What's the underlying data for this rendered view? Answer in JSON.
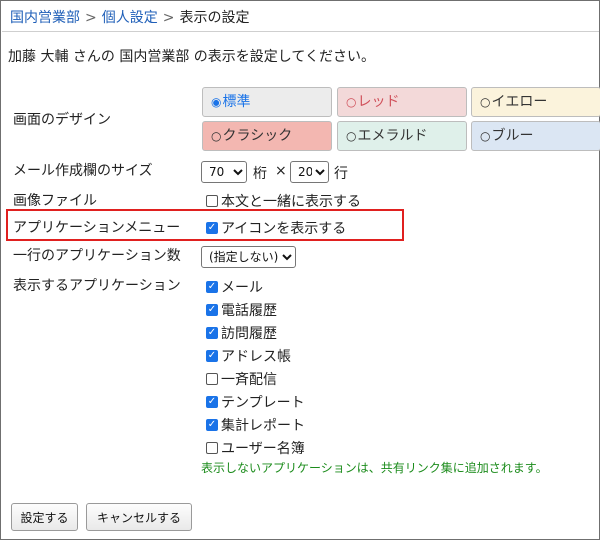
{
  "breadcrumb": {
    "items": [
      "国内営業部",
      "個人設定"
    ],
    "current": "表示の設定",
    "separator": ">"
  },
  "intro": "加藤 大輔 さんの 国内営業部 の表示を設定してください。",
  "design": {
    "label": "画面のデザイン",
    "selected": "標準",
    "options": [
      {
        "label": "標準",
        "bg": "#ececec",
        "color": "#1a73e8",
        "dot": "◉"
      },
      {
        "label": "レッド",
        "bg": "#f3d9d9",
        "color": "#d0505a",
        "dot": "○"
      },
      {
        "label": "イエロー",
        "bg": "#fbf3dc",
        "color": "#333333",
        "dot": "○"
      },
      {
        "label": "クラシック",
        "bg": "#f3b7b1",
        "color": "#333333",
        "dot": "○"
      },
      {
        "label": "エメラルド",
        "bg": "#dff0ea",
        "color": "#333333",
        "dot": "○"
      },
      {
        "label": "ブルー",
        "bg": "#dbe6f3",
        "color": "#333333",
        "dot": "○"
      }
    ]
  },
  "mail_size": {
    "label": "メール作成欄のサイズ",
    "cols_value": "70",
    "cols_unit": "桁",
    "times": "×",
    "rows_value": "20",
    "rows_unit": "行"
  },
  "image_file": {
    "label": "画像ファイル",
    "checkbox_label": "本文と一緒に表示する",
    "checked": false
  },
  "app_menu": {
    "label": "アプリケーションメニュー",
    "checkbox_label": "アイコンを表示する",
    "checked": true,
    "highlight_color": "#e0201f"
  },
  "apps_per_row": {
    "label": "一行のアプリケーション数",
    "value": "(指定しない)"
  },
  "apps": {
    "label": "表示するアプリケーション",
    "items": [
      {
        "label": "メール",
        "checked": true
      },
      {
        "label": "電話履歴",
        "checked": true
      },
      {
        "label": "訪問履歴",
        "checked": true
      },
      {
        "label": "アドレス帳",
        "checked": true
      },
      {
        "label": "一斉配信",
        "checked": false
      },
      {
        "label": "テンプレート",
        "checked": true
      },
      {
        "label": "集計レポート",
        "checked": true
      },
      {
        "label": "ユーザー名簿",
        "checked": false
      }
    ],
    "note": "表示しないアプリケーションは、共有リンク集に追加されます。"
  },
  "buttons": {
    "submit": "設定する",
    "cancel": "キャンセルする"
  }
}
